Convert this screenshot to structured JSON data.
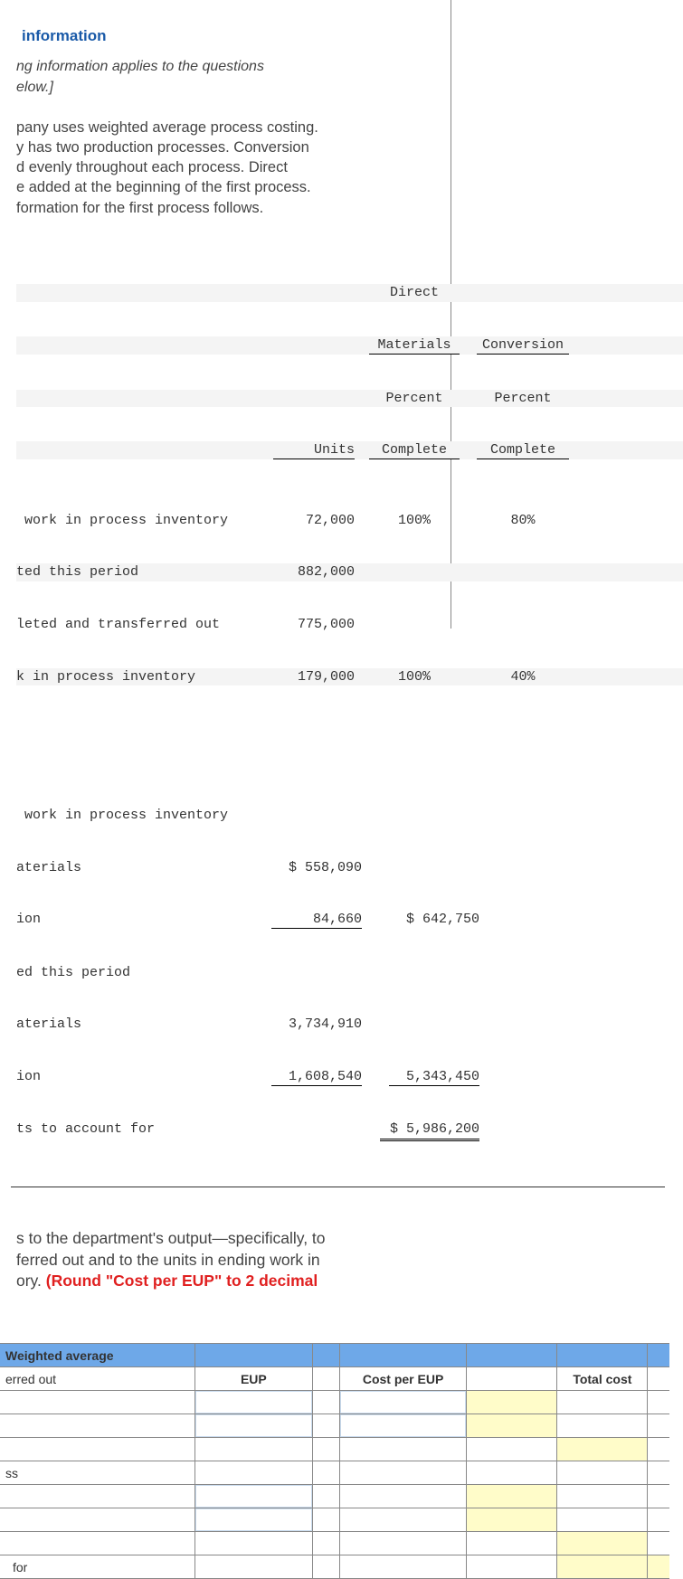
{
  "header": {
    "title": "information",
    "note_l1": "ng information applies to the questions",
    "note_l2": "elow.]"
  },
  "paragraph": {
    "l1": "pany uses weighted average process costing.",
    "l2": "y has two production processes. Conversion",
    "l3": "d evenly throughout each process. Direct",
    "l4": "e added at the beginning of the first process.",
    "l5": "formation for the first process follows."
  },
  "table": {
    "head": {
      "dm": "Direct",
      "materials": "Materials",
      "conv": "Conversion",
      "units": "Units",
      "pct": "Percent",
      "complete": "Complete"
    },
    "rows": {
      "bwip": {
        "label": " work in process inventory",
        "units": "72,000",
        "mat": "100%",
        "conv": "80%"
      },
      "start": {
        "label": "ted this period",
        "units": "882,000",
        "mat": "",
        "conv": ""
      },
      "xferout": {
        "label": "leted and transferred out",
        "units": "775,000",
        "mat": "",
        "conv": ""
      },
      "ewip": {
        "label": "k in process inventory",
        "units": "179,000",
        "mat": "100%",
        "conv": "40%"
      }
    },
    "costs": {
      "bwip_label": " work in process inventory",
      "mat_label": "aterials",
      "conv_label": "ion",
      "added_label": "ed this period",
      "total_label": "ts to account for",
      "bwip_mat": "$ 558,090",
      "bwip_conv": "84,660",
      "bwip_total": "$ 642,750",
      "added_mat": "3,734,910",
      "added_conv": "1,608,540",
      "added_total": "5,343,450",
      "grand_total": "$ 5,986,200"
    }
  },
  "question": {
    "l1": "s to the department's output—specifically, to",
    "l2": "ferred out and to the units in ending work in",
    "l3": "ory. ",
    "bold": "(Round \"Cost per EUP\" to 2 decimal"
  },
  "answer_table": {
    "hdr_method": "Weighted average",
    "hdr_eup": "EUP",
    "hdr_cpe": "Cost per EUP",
    "hdr_tc": "Total cost",
    "row_xfer": "erred out",
    "row_ss": "ss",
    "row_for": "for"
  }
}
